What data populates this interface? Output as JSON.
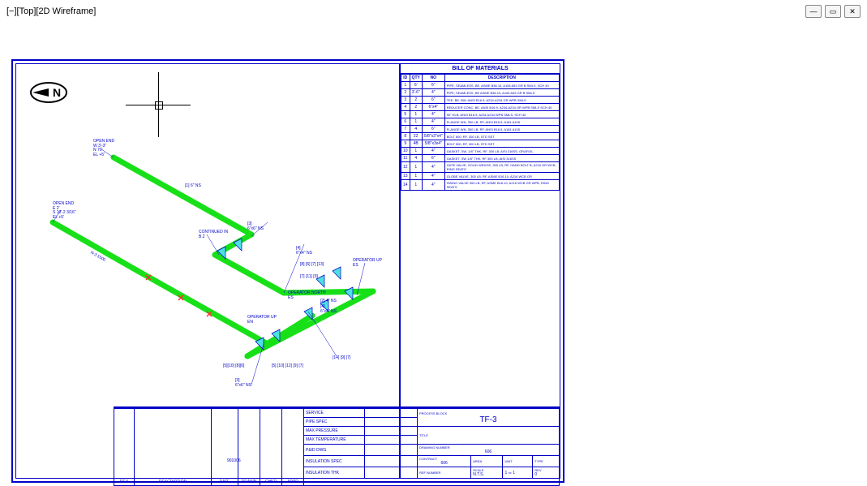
{
  "titlebar": {
    "text": "[−][Top][2D Wireframe]"
  },
  "bom": {
    "title": "BILL OF MATERIALS",
    "headers": [
      "ID",
      "QTY",
      "NO",
      "DESCRIPTION"
    ],
    "rows": [
      {
        "id": "1",
        "qty": "6'",
        "no": "6\"",
        "desc": "PIPE, SEAMLESS, BE, ASME B36.10, A106 A53 GR B SMLS, SCH 40"
      },
      {
        "id": "2",
        "qty": "3'-6\"",
        "no": "4\"",
        "desc": "PIPE, SEAMLESS, BE ASME B36.10, A106 A53 GR B SMLS"
      },
      {
        "id": "3",
        "qty": "2",
        "no": "6\"",
        "desc": "TEE, BE, BW, ANSI B16.9, A234-A234 GR WPB SMLS"
      },
      {
        "id": "4",
        "qty": "2",
        "no": "6\"x4\"",
        "desc": "REDUCER CONC, BE, ANSI B16.9, A234-A234 GR WPB SMLS SCH 40"
      },
      {
        "id": "5",
        "qty": "1",
        "no": "4\"",
        "desc": "90° ELB, ANSI B16.9, A234 A234 WPB SMLS, SCH 40"
      },
      {
        "id": "6",
        "qty": "1",
        "no": "4\"",
        "desc": "FLANGE WN, 300 LB, RF, ANSI B16.5, A181 A105"
      },
      {
        "id": "7",
        "qty": "4",
        "no": "6\"",
        "desc": "FLANGE WN, 300 LB, RF, ANSI B16.5, A181 A105"
      },
      {
        "id": "8",
        "qty": "22",
        "no": "5/8\"x3\"x4\"",
        "desc": "BOLT 600, RF, 300 LB, STD SET"
      },
      {
        "id": "9",
        "qty": "4B",
        "no": "5/8\"x3x4\"",
        "desc": "BOLT 500, RF, 300 LB, STD SET"
      },
      {
        "id": "10",
        "qty": "1",
        "no": "4\"",
        "desc": "GASKET, SW, 1/8\" THK, RF, 300 LB, AISI 316SS, GRAFOIL"
      },
      {
        "id": "11",
        "qty": "4",
        "no": "6\"",
        "desc": "GASKET, SW 1/8\" THK, RF 300 LB, AISI 316SS"
      },
      {
        "id": "12",
        "qty": "1",
        "no": "4\"",
        "desc": "GATE VALVE, SOLID WEDGE, 300 LB, RF, HAND BOLT B, A216 GR WCB, RING SEATS"
      },
      {
        "id": "13",
        "qty": "1",
        "no": "4\"",
        "desc": "GLOBE VALVE, 300 LB, RF, ASME B16.10, A216 WCB GR"
      },
      {
        "id": "14",
        "qty": "1",
        "no": "4\"",
        "desc": "SWING VALVE 300 LB, RF, ASME B16.10, A216 WCB GR WPB, RING SEATS"
      }
    ]
  },
  "title_block": {
    "fields": [
      "SERVICE",
      "PIPE SPEC",
      "MAX PRESSURE",
      "MAX TEMPERATURE",
      "P&ID DWG",
      "INSULATION SPEC",
      "INSULATION THK"
    ],
    "rev_headers": [
      "REV",
      "DESCRIPTION",
      "DATE",
      "DRAWN",
      "CHKD",
      "APPD"
    ],
    "date_val": "901006",
    "process_block": "PROCESS BLOCK",
    "tf3": "TF-3",
    "drawing_number_label": "DRAWING NUMBER",
    "drawing_number": "606",
    "contract": "CONTRACT",
    "contract_val": "606",
    "area": "AREA",
    "unit": "UNIT",
    "type": "TYPE",
    "ref_number": "REF NUMBER",
    "scale_label": "SCALE",
    "scale": "N.T.S.",
    "sheet": "1",
    "of": "OF",
    "total": "1",
    "rev_label": "REV",
    "rev_val": "0",
    "title_label": "TITLE"
  },
  "annotations": {
    "open_end1": "OPEN END\nW 3'-3\"\nN 70'\nEL +5'",
    "open_end2": "OPEN END\nE 2'\nS 10'-2 3/16\"\nEL +5'",
    "pipe_size1": "[1]  6\" NS",
    "pipe_size2": "[2]  4\" NS",
    "tee1": "[3]\n6\"x6\" NS",
    "tee2": "[3]\n6\"x6\" NS",
    "red1": "[4]\n6\"x4\" NS",
    "red2": "[4]\n6\"x4\" NS",
    "continued": "CONTINUED IN\nB.2",
    "line_no": "N-3 1500",
    "operator_up1": "OPERATOR UP\nES",
    "operator_up2": "OPERATOR UP\nEN",
    "operator_north": "OPERATOR NORTH\nES",
    "elbow1": "[8] [6] [7] [13]",
    "marks1": "[5][10] [8][6]",
    "marks2": "[7] [11] [9]",
    "marks3": "[14] [9] [7]",
    "marks4": "[5] [10] [12] [9] [7]"
  }
}
